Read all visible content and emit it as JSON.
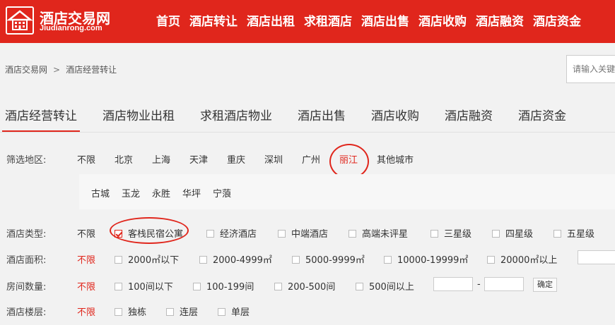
{
  "header": {
    "site_name": "酒店交易网",
    "site_domain": "Jiudianrong.com",
    "nav": [
      "首页",
      "酒店转让",
      "酒店出租",
      "求租酒店",
      "酒店出售",
      "酒店收购",
      "酒店融资",
      "酒店资金"
    ]
  },
  "breadcrumb": {
    "home": "酒店交易网",
    "separator": ">",
    "current": "酒店经营转让"
  },
  "search": {
    "placeholder": "请输入关键"
  },
  "tabs": [
    "酒店经营转让",
    "酒店物业出租",
    "求租酒店物业",
    "酒店出售",
    "酒店收购",
    "酒店融资",
    "酒店资金"
  ],
  "filters": {
    "region": {
      "label": "筛选地区:",
      "options": [
        "不限",
        "北京",
        "上海",
        "天津",
        "重庆",
        "深圳",
        "广州",
        "丽江",
        "其他城市"
      ],
      "selected": "丽江",
      "sub_options": [
        "古城",
        "玉龙",
        "永胜",
        "华坪",
        "宁蒗"
      ]
    },
    "hotel_type": {
      "label": "酒店类型:",
      "all": "不限",
      "options": [
        "客栈民宿公寓",
        "经济酒店",
        "中端酒店",
        "高端未评星",
        "三星级",
        "四星级",
        "五星级"
      ],
      "checked": "客栈民宿公寓"
    },
    "area": {
      "label": "酒店面积:",
      "all": "不限",
      "options": [
        "2000㎡以下",
        "2000-4999㎡",
        "5000-9999㎡",
        "10000-19999㎡",
        "20000㎡以上"
      ]
    },
    "rooms": {
      "label": "房间数量:",
      "all": "不限",
      "options": [
        "100间以下",
        "100-199间",
        "200-500间",
        "500间以上"
      ],
      "range_separator": "-",
      "confirm": "确定"
    },
    "floors": {
      "label": "酒店楼层:",
      "all": "不限",
      "options": [
        "独栋",
        "连层",
        "单层"
      ]
    }
  },
  "colors": {
    "brand_red": "#e0261c",
    "page_bg": "#f2f2f2"
  }
}
